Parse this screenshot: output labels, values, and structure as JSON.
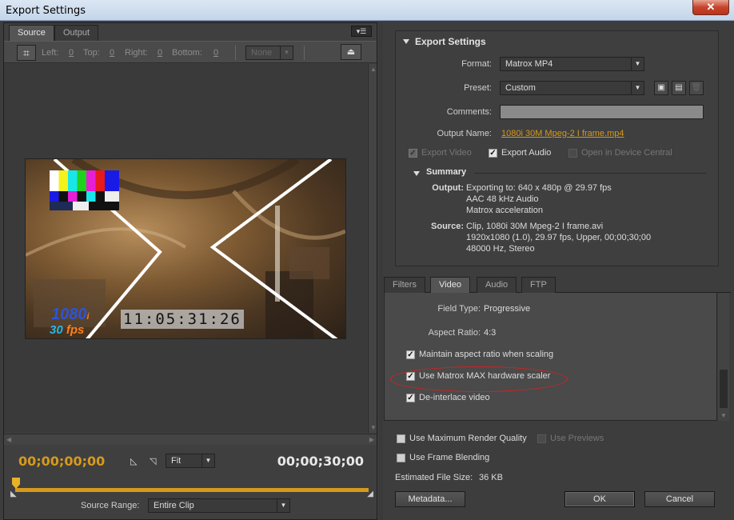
{
  "window": {
    "title": "Export Settings",
    "close": "✕"
  },
  "left": {
    "tabs": [
      "Source",
      "Output"
    ],
    "crop": {
      "left_label": "Left:",
      "left_value": "0",
      "top_label": "Top:",
      "top_value": "0",
      "right_label": "Right:",
      "right_value": "0",
      "bottom_label": "Bottom:",
      "bottom_value": "0",
      "aspect": "None"
    },
    "video_overlay": {
      "timecode": "11:05:31:26",
      "res": "1080",
      "res_suffix": "i",
      "fps": "30",
      "fps_suffix": "fps"
    },
    "time_in": "00;00;00;00",
    "time_out": "00;00;30;00",
    "fit": "Fit",
    "source_range_label": "Source Range:",
    "source_range": "Entire Clip"
  },
  "export": {
    "title": "Export Settings",
    "format_label": "Format:",
    "format": "Matrox MP4",
    "preset_label": "Preset:",
    "preset": "Custom",
    "comments_label": "Comments:",
    "output_name_label": "Output Name:",
    "output_name": "1080i 30M Mpeg-2 I frame.mp4",
    "export_video": "Export Video",
    "export_audio": "Export Audio",
    "open_device": "Open in Device Central",
    "summary_title": "Summary",
    "output_label": "Output:",
    "output_lines": [
      "Exporting to: 640 x 480p @ 29.97 fps",
      "AAC 48 kHz Audio",
      "Matrox acceleration"
    ],
    "source_label": "Source:",
    "source_lines": [
      "Clip, 1080i 30M Mpeg-2 I frame.avi",
      "1920x1080 (1.0), 29.97 fps, Upper, 00;00;30;00",
      "48000 Hz, Stereo"
    ]
  },
  "tabs2": [
    "Filters",
    "Video",
    "Audio",
    "FTP"
  ],
  "video": {
    "field_type_label": "Field Type:",
    "field_type": "Progressive",
    "aspect_label": "Aspect Ratio:",
    "aspect": "4:3",
    "maintain": "Maintain aspect ratio when scaling",
    "hw_scaler": "Use Matrox MAX hardware scaler",
    "deinterlace": "De-interlace video"
  },
  "bottom": {
    "max_quality": "Use Maximum Render Quality",
    "use_previews": "Use Previews",
    "frame_blending": "Use Frame Blending",
    "est_label": "Estimated File Size:",
    "est_value": "36 KB",
    "metadata": "Metadata...",
    "ok": "OK",
    "cancel": "Cancel"
  },
  "colors": {
    "accent": "#d69a1b",
    "panel": "#3d3d3d",
    "highlight": "#d42121"
  }
}
